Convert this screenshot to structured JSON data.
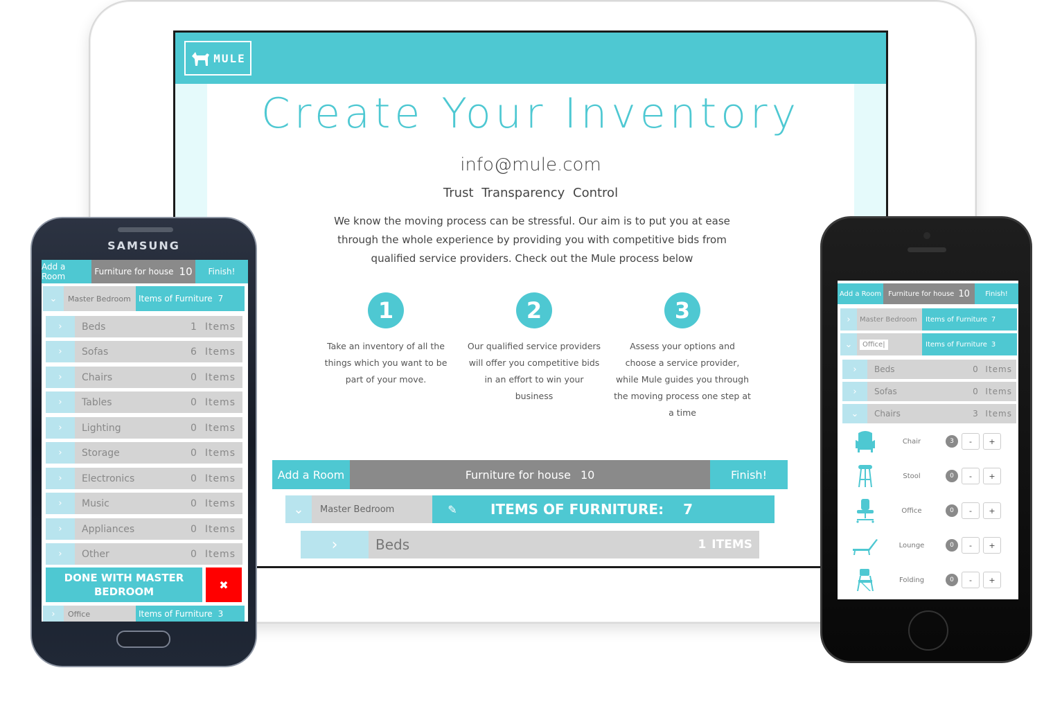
{
  "colors": {
    "accent": "#4ec8d2",
    "gray_bar": "#8a8a8a",
    "light_row": "#d4d4d4",
    "chevron_bg": "#b8e4ee",
    "danger": "#ff0000"
  },
  "tablet": {
    "logo_text": "MULE",
    "title": "Create Your Inventory",
    "email": "info@mule.com",
    "tagline": "Trust  Transparency  Control",
    "intro": "We know the moving process can be stressful. Our aim is to put you at ease through the whole experience by providing you with competitive bids from qualified service providers. Check out the Mule process below",
    "steps": [
      {
        "num": "1",
        "text": "Take an inventory of all the things which you want to be part of your move."
      },
      {
        "num": "2",
        "text": "Our qualified service providers will offer you competitive bids in an effort to win your business"
      },
      {
        "num": "3",
        "text": "Assess your options and choose a service provider, while Mule guides you through the moving process one step at a time"
      }
    ],
    "toolbar": {
      "add_room": "Add a Room",
      "furniture_label": "Furniture for house",
      "furniture_count": "10",
      "finish": "Finish!"
    },
    "room": {
      "name": "Master Bedroom",
      "items_label": "ITEMS OF FURNITURE:",
      "items_count": "7"
    },
    "first_item": {
      "name": "Beds",
      "count": "1",
      "unit": "ITEMS"
    }
  },
  "samsung": {
    "brand": "SAMSUNG",
    "toolbar": {
      "add_room": "Add a Room",
      "furniture_label": "Furniture for house",
      "furniture_count": "10",
      "finish": "Finish!"
    },
    "room": {
      "name": "Master Bedroom",
      "items_label": "Items of Furniture",
      "items_count": "7"
    },
    "items": [
      {
        "name": "Beds",
        "count": "1",
        "unit": "Items"
      },
      {
        "name": "Sofas",
        "count": "6",
        "unit": "Items"
      },
      {
        "name": "Chairs",
        "count": "0",
        "unit": "Items"
      },
      {
        "name": "Tables",
        "count": "0",
        "unit": "Items"
      },
      {
        "name": "Lighting",
        "count": "0",
        "unit": "Items"
      },
      {
        "name": "Storage",
        "count": "0",
        "unit": "Items"
      },
      {
        "name": "Electronics",
        "count": "0",
        "unit": "Items"
      },
      {
        "name": "Music",
        "count": "0",
        "unit": "Items"
      },
      {
        "name": "Appliances",
        "count": "0",
        "unit": "Items"
      },
      {
        "name": "Other",
        "count": "0",
        "unit": "Items"
      }
    ],
    "done_label": "DONE WITH MASTER BEDROOM",
    "close_glyph": "✖",
    "next_room": {
      "name": "Office",
      "items_label": "Items of Furniture",
      "items_count": "3"
    }
  },
  "iphone": {
    "toolbar": {
      "add_room": "Add a Room",
      "furniture_label": "Furniture for house",
      "furniture_count": "10",
      "finish": "Finish!"
    },
    "rooms": [
      {
        "name": "Master Bedroom",
        "items_label": "Items of Furniture",
        "items_count": "7"
      },
      {
        "name": "Office|",
        "items_label": "Items of Furniture",
        "items_count": "3"
      }
    ],
    "items": [
      {
        "name": "Beds",
        "count": "0",
        "unit": "Items"
      },
      {
        "name": "Sofas",
        "count": "0",
        "unit": "Items"
      },
      {
        "name": "Chairs",
        "count": "3",
        "unit": "Items"
      }
    ],
    "chairs": [
      {
        "name": "Chair",
        "count": "3",
        "icon": "armchair-icon"
      },
      {
        "name": "Stool",
        "count": "0",
        "icon": "stool-icon"
      },
      {
        "name": "Office",
        "count": "0",
        "icon": "office-chair-icon"
      },
      {
        "name": "Lounge",
        "count": "0",
        "icon": "lounge-chair-icon"
      },
      {
        "name": "Folding",
        "count": "0",
        "icon": "folding-chair-icon"
      }
    ],
    "minus": "-",
    "plus": "+"
  }
}
